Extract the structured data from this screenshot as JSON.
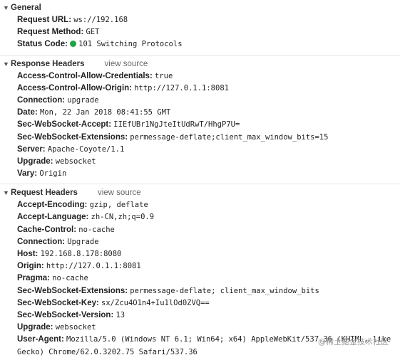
{
  "general": {
    "title": "General",
    "request_url_label": "Request URL:",
    "request_url": "ws://192.168",
    "request_method_label": "Request Method:",
    "request_method": "GET",
    "status_code_label": "Status Code:",
    "status_code": "101 Switching Protocols",
    "status_color": "#1ea446"
  },
  "response_headers": {
    "title": "Response Headers",
    "view_source": "view source",
    "items": [
      {
        "key": "Access-Control-Allow-Credentials:",
        "value": "true"
      },
      {
        "key": "Access-Control-Allow-Origin:",
        "value": "http://127.0.1.1:8081"
      },
      {
        "key": "Connection:",
        "value": "upgrade"
      },
      {
        "key": "Date:",
        "value": "Mon, 22 Jan 2018 08:41:55 GMT"
      },
      {
        "key": "Sec-WebSocket-Accept:",
        "value": "IIEfUBr1NgJteItUdRwT/HhgP7U="
      },
      {
        "key": "Sec-WebSocket-Extensions:",
        "value": "permessage-deflate;client_max_window_bits=15"
      },
      {
        "key": "Server:",
        "value": "Apache-Coyote/1.1"
      },
      {
        "key": "Upgrade:",
        "value": "websocket"
      },
      {
        "key": "Vary:",
        "value": "Origin"
      }
    ]
  },
  "request_headers": {
    "title": "Request Headers",
    "view_source": "view source",
    "items": [
      {
        "key": "Accept-Encoding:",
        "value": "gzip, deflate"
      },
      {
        "key": "Accept-Language:",
        "value": "zh-CN,zh;q=0.9"
      },
      {
        "key": "Cache-Control:",
        "value": "no-cache"
      },
      {
        "key": "Connection:",
        "value": "Upgrade"
      },
      {
        "key": "Host:",
        "value": "192.168.8.178:8080"
      },
      {
        "key": "Origin:",
        "value": "http://127.0.1.1:8081"
      },
      {
        "key": "Pragma:",
        "value": "no-cache"
      },
      {
        "key": "Sec-WebSocket-Extensions:",
        "value": "permessage-deflate; client_max_window_bits"
      },
      {
        "key": "Sec-WebSocket-Key:",
        "value": "sx/Zcu4O1n4+Iu1lOd0ZVQ=="
      },
      {
        "key": "Sec-WebSocket-Version:",
        "value": "13"
      },
      {
        "key": "Upgrade:",
        "value": "websocket"
      },
      {
        "key": "User-Agent:",
        "value": "Mozilla/5.0 (Windows NT 6.1; Win64; x64) AppleWebKit/537.36 (KHTML, like Gecko) Chrome/62.0.3202.75 Safari/537.36"
      }
    ]
  },
  "watermark": "@稀土掘金技术社区",
  "icons": {
    "expand": "triangle-down-icon",
    "status": "status-dot-icon"
  }
}
